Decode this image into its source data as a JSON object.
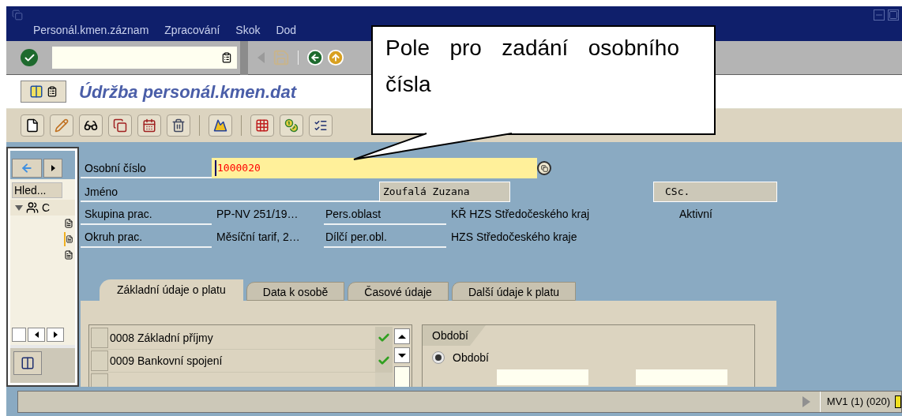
{
  "window": {
    "menu": [
      "Personál.kmen.záznam",
      "Zpracování",
      "Skok",
      "Dod"
    ]
  },
  "title": "Údržba personál.kmen.dat",
  "callout": {
    "text": "Pole pro zadání osobního čísla"
  },
  "navigator": {
    "search_button": "Hled...",
    "tree": [
      {
        "label": "C",
        "expanded": true,
        "children": [
          {
            "selected": false
          },
          {
            "selected": true
          },
          {
            "selected": false
          }
        ]
      }
    ]
  },
  "header": {
    "personnel_number": {
      "label": "Osobní číslo",
      "value": "1000020"
    },
    "name": {
      "label": "Jméno",
      "value": "Zoufalá Zuzana",
      "title": "CSc."
    },
    "rows": [
      {
        "label": "Skupina prac.",
        "value": "PP-NV 251/19…",
        "label2": "Pers.oblast",
        "value2": "KŘ HZS Středočeského kraj",
        "status": "Aktivní"
      },
      {
        "label": "Okruh prac.",
        "value": "Měsíční tarif, 2…",
        "label2": "Dílčí per.obl.",
        "value2": "HZS Středočeského kraje"
      }
    ]
  },
  "tabs": [
    {
      "label": "Základní údaje o platu",
      "selected": true
    },
    {
      "label": "Data k osobě",
      "selected": false
    },
    {
      "label": "Časové údaje",
      "selected": false
    },
    {
      "label": "Další údaje k platu",
      "selected": false
    }
  ],
  "infotypes": [
    {
      "label": "0008 Základní příjmy",
      "checked": true
    },
    {
      "label": "0009 Bankovní spojení",
      "checked": true
    },
    {
      "checked": false
    }
  ],
  "period_group": {
    "title": "Období",
    "options": [
      {
        "label": "Období",
        "selected": true
      }
    ]
  },
  "status_bar": {
    "session": "MV1 (1) (020)"
  }
}
